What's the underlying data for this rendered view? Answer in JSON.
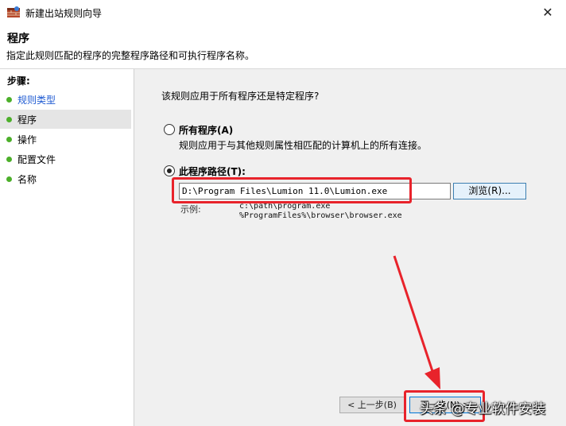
{
  "window": {
    "title": "新建出站规则向导",
    "close_glyph": "✕"
  },
  "header": {
    "title": "程序",
    "description": "指定此规则匹配的程序的完整程序路径和可执行程序名称。"
  },
  "sidebar": {
    "heading": "步骤:",
    "items": [
      {
        "label": "规则类型",
        "state": "done"
      },
      {
        "label": "程序",
        "state": "current"
      },
      {
        "label": "操作",
        "state": "pending"
      },
      {
        "label": "配置文件",
        "state": "pending"
      },
      {
        "label": "名称",
        "state": "pending"
      }
    ]
  },
  "main": {
    "question": "该规则应用于所有程序还是特定程序?",
    "option_all": {
      "label": "所有程序(A)",
      "description": "规则应用于与其他规则属性相匹配的计算机上的所有连接。",
      "checked": false
    },
    "option_path": {
      "label": "此程序路径(T):",
      "checked": true
    },
    "path_value": "D:\\Program Files\\Lumion 11.0\\Lumion.exe",
    "browse_label": "浏览(R)...",
    "example_label": "示例:",
    "example_line1": "c:\\path\\program.exe",
    "example_line2": "%ProgramFiles%\\browser\\browser.exe"
  },
  "footer": {
    "back_label": "< 上一步(B)",
    "next_label": "下一步(N) >"
  },
  "watermark": "头条 @专业软件安装",
  "colors": {
    "annotation_red": "#e8232b",
    "step_dot_green": "#4caf2a",
    "link_blue": "#1e5ad2",
    "panel_gray": "#f0f0f0"
  }
}
